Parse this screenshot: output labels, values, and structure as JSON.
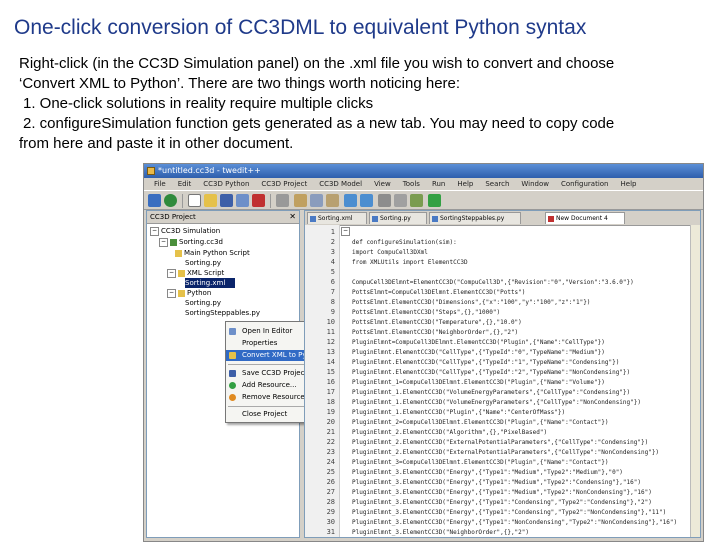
{
  "slide": {
    "title": "One-click conversion of CC3DML to equivalent Python syntax",
    "line1": "Right-click (in the CC3D Simulation panel) on the .xml file you wish to convert and choose",
    "line2": "‘Convert XML to Python’. There are two things worth noticing here:",
    "line3": "1. One-click solutions in reality require multiple clicks",
    "line4": "2. configureSimulation function gets generated as a new tab. You may need to copy code",
    "line5": "from here and paste it in other document."
  },
  "window": {
    "title": "*untitled.cc3d - twedit++",
    "menus": [
      "File",
      "Edit",
      "CC3D Python",
      "CC3D Project",
      "CC3D Model",
      "View",
      "Tools",
      "Run",
      "Help",
      "Search",
      "Window",
      "Configuration",
      "Help"
    ]
  },
  "left_panel": {
    "header": "CC3D Project",
    "items": [
      "CC3D Simulation",
      "Sorting.cc3d",
      "Main Python Script",
      "Sorting.py",
      "XML Script",
      "Sorting.xml",
      "Python",
      "Sorting.py",
      "SortingSteppables.py"
    ]
  },
  "context_menu": {
    "items": [
      "Open In Editor",
      "Properties",
      "Convert XML to Python",
      "Save CC3D Project",
      "Add Resource...",
      "Remove Resources",
      "Close Project"
    ],
    "highlighted_index": 2
  },
  "editor": {
    "tabs": [
      "Sorting.xml",
      "Sorting.py",
      "SortingSteppables.py",
      "New Document 4"
    ],
    "active_tab": 3,
    "line_numbers": [
      "1",
      "2",
      "3",
      "4",
      "5",
      "6",
      "7",
      "8",
      "9",
      "10",
      "11",
      "12",
      "13",
      "14",
      "15",
      "16",
      "17",
      "18",
      "19",
      "20",
      "21",
      "22",
      "23",
      "24",
      "25",
      "26",
      "27",
      "28",
      "29",
      "30",
      "31"
    ],
    "code_lines": [
      "",
      "def configureSimulation(sim):",
      "    import CompuCell3DXml",
      "    from XMLUtils import ElementCC3D",
      "",
      "    CompuCell3DElmnt=ElementCC3D(\"CompuCell3D\",{\"Revision\":\"0\",\"Version\":\"3.6.0\"})",
      "    PottsElmnt=CompuCell3DElmnt.ElementCC3D(\"Potts\")",
      "    PottsElmnt.ElementCC3D(\"Dimensions\",{\"x\":\"100\",\"y\":\"100\",\"z\":\"1\"})",
      "    PottsElmnt.ElementCC3D(\"Steps\",{},\"1000\")",
      "    PottsElmnt.ElementCC3D(\"Temperature\",{},\"10.0\")",
      "    PottsElmnt.ElementCC3D(\"NeighborOrder\",{},\"2\")",
      "    PluginElmnt=CompuCell3DElmnt.ElementCC3D(\"Plugin\",{\"Name\":\"CellType\"})",
      "    PluginElmnt.ElementCC3D(\"CellType\",{\"TypeId\":\"0\",\"TypeName\":\"Medium\"})",
      "    PluginElmnt.ElementCC3D(\"CellType\",{\"TypeId\":\"1\",\"TypeName\":\"Condensing\"})",
      "    PluginElmnt.ElementCC3D(\"CellType\",{\"TypeId\":\"2\",\"TypeName\":\"NonCondensing\"})",
      "    PluginElmnt_1=CompuCell3DElmnt.ElementCC3D(\"Plugin\",{\"Name\":\"Volume\"})",
      "    PluginElmnt_1.ElementCC3D(\"VolumeEnergyParameters\",{\"CellType\":\"Condensing\"})",
      "    PluginElmnt_1.ElementCC3D(\"VolumeEnergyParameters\",{\"CellType\":\"NonCondensing\"})",
      "    PluginElmnt_1.ElementCC3D(\"Plugin\",{\"Name\":\"CenterOfMass\"})",
      "    PluginElmnt_2=CompuCell3DElmnt.ElementCC3D(\"Plugin\",{\"Name\":\"Contact\"})",
      "    PluginElmnt_2.ElementCC3D(\"Algorithm\",{},\"PixelBased\")",
      "    PluginElmnt_2.ElementCC3D(\"ExternalPotentialParameters\",{\"CellType\":\"Condensing\"})",
      "    PluginElmnt_2.ElementCC3D(\"ExternalPotentialParameters\",{\"CellType\":\"NonCondensing\"})",
      "    PluginElmnt_3=CompuCell3DElmnt.ElementCC3D(\"Plugin\",{\"Name\":\"Contact\"})",
      "    PluginElmnt_3.ElementCC3D(\"Energy\",{\"Type1\":\"Medium\",\"Type2\":\"Medium\"},\"0\")",
      "    PluginElmnt_3.ElementCC3D(\"Energy\",{\"Type1\":\"Medium\",\"Type2\":\"Condensing\"},\"16\")",
      "    PluginElmnt_3.ElementCC3D(\"Energy\",{\"Type1\":\"Medium\",\"Type2\":\"NonCondensing\"},\"16\")",
      "    PluginElmnt_3.ElementCC3D(\"Energy\",{\"Type1\":\"Condensing\",\"Type2\":\"Condensing\"},\"2\")",
      "    PluginElmnt_3.ElementCC3D(\"Energy\",{\"Type1\":\"Condensing\",\"Type2\":\"NonCondensing\"},\"11\")",
      "    PluginElmnt_3.ElementCC3D(\"Energy\",{\"Type1\":\"NonCondensing\",\"Type2\":\"NonCondensing\"},\"16\")",
      "    PluginElmnt_3.ElementCC3D(\"NeighborOrder\",{},\"2\")"
    ]
  },
  "colors": {
    "title": "#1f3a8a",
    "highlight": "#316ac5",
    "selection": "#0a246a"
  }
}
